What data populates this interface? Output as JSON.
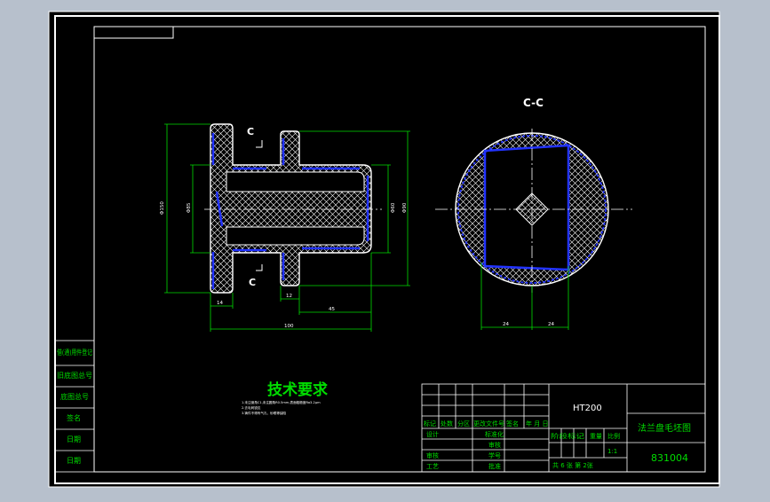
{
  "drawing": {
    "section_label": "C-C",
    "section_marker": "C",
    "tech_title": "技术要求",
    "tech_notes": [
      "1.未注倒角C1,未注圆角R0.5mm,表面粗糙度Ra3.2μm",
      "2.去毛刺锐边",
      "3.铸件不得有气孔、砂眼等缺陷"
    ],
    "dims_left_view": {
      "overall_height": "Φ150",
      "hub_height": "Φ85",
      "right_height_inner": "Φ60",
      "right_height_outer": "Φ90",
      "flange_thickness": "14",
      "inner_flange": "12",
      "hub_length": "45",
      "overall_length": "100"
    },
    "dims_section_view": {
      "left": "24",
      "right": "24"
    }
  },
  "side_table": {
    "rows": [
      "借(通)用件登记",
      "旧底图总号",
      "底图总号",
      "签名",
      "日期",
      "日期"
    ]
  },
  "title_block": {
    "material": "HT200",
    "part_name": "法兰盘毛坯图",
    "drawing_number": "831004",
    "change_header": [
      "标记",
      "处数",
      "分区",
      "更改文件号",
      "签名",
      "年 月 日"
    ],
    "roles": [
      "设计",
      "审核",
      "工艺"
    ],
    "roles_mid": [
      "标准化",
      "审核",
      "学号",
      "批准"
    ],
    "stage_header": [
      "阶段标记",
      "重量",
      "比例"
    ],
    "scale": "1:1",
    "sheet_info": "共 6 张   第 2张"
  }
}
